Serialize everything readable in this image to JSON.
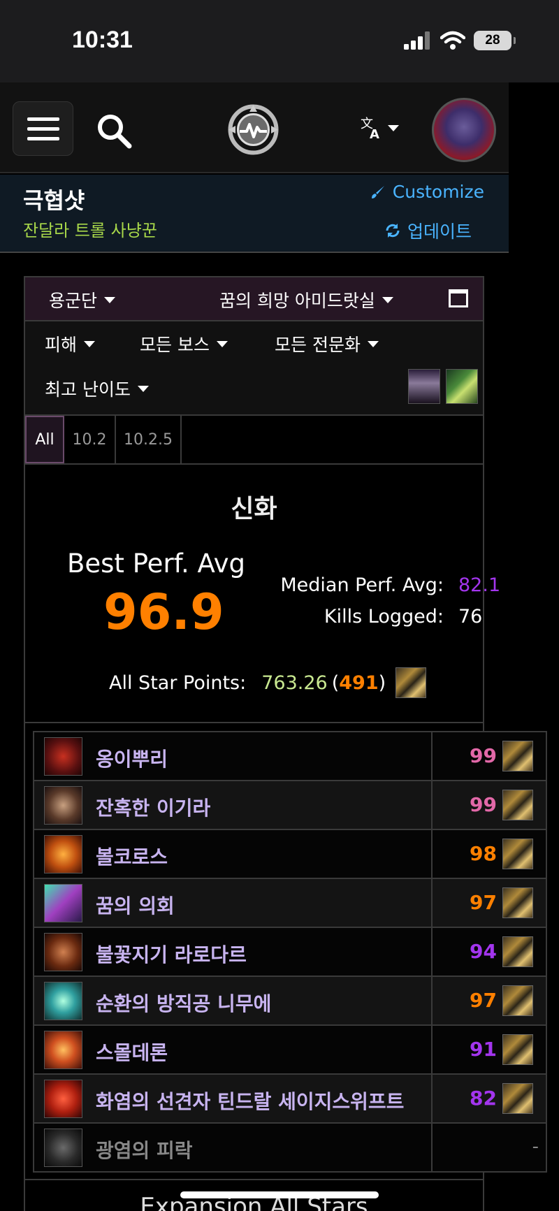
{
  "status": {
    "time": "10:31",
    "battery": "28"
  },
  "header": {
    "char_name": "극협샷",
    "char_sub": "잔달라 트롤 사냥꾼",
    "customize": "Customize",
    "update": "업데이트"
  },
  "filters": {
    "region": "용군단",
    "raid": "꿈의 희망 아미드랏실",
    "metric": "피해",
    "bosses": "모든 보스",
    "spec": "모든 전문화",
    "difficulty": "최고 난이도"
  },
  "tabs": [
    "All",
    "10.2",
    "10.2.5"
  ],
  "summary": {
    "difficulty_title": "신화",
    "best_label": "Best Perf. Avg",
    "best_value": "96.9",
    "median_label": "Median Perf. Avg:",
    "median_value": "82.1",
    "kills_label": "Kills Logged:",
    "kills_value": "76",
    "stars_label": "All Star Points:",
    "stars_value": "763.26",
    "stars_open": "(",
    "stars_rank": "491",
    "stars_close": ")"
  },
  "bosses": [
    {
      "name": "옹이뿌리",
      "score": "99",
      "color": "#e268a8"
    },
    {
      "name": "잔혹한 이기라",
      "score": "99",
      "color": "#e268a8"
    },
    {
      "name": "볼코로스",
      "score": "98",
      "color": "#ff8000"
    },
    {
      "name": "꿈의 의회",
      "score": "97",
      "color": "#ff8000"
    },
    {
      "name": "불꽃지기 라로다르",
      "score": "94",
      "color": "#a335ee"
    },
    {
      "name": "순환의 방직공 니무에",
      "score": "97",
      "color": "#ff8000"
    },
    {
      "name": "스몰데론",
      "score": "91",
      "color": "#a335ee"
    },
    {
      "name": "화염의 선견자 틴드랄 세이지스위프트",
      "score": "82",
      "color": "#a335ee"
    },
    {
      "name": "광염의 피락",
      "score": "-",
      "color": "#888888"
    }
  ],
  "footer": {
    "title": "Expansion All Stars"
  },
  "colors": {
    "accent_blue": "#4ab4ff",
    "legendary": "#ff8000",
    "epic": "#a335ee",
    "astounding": "#e268a8"
  }
}
